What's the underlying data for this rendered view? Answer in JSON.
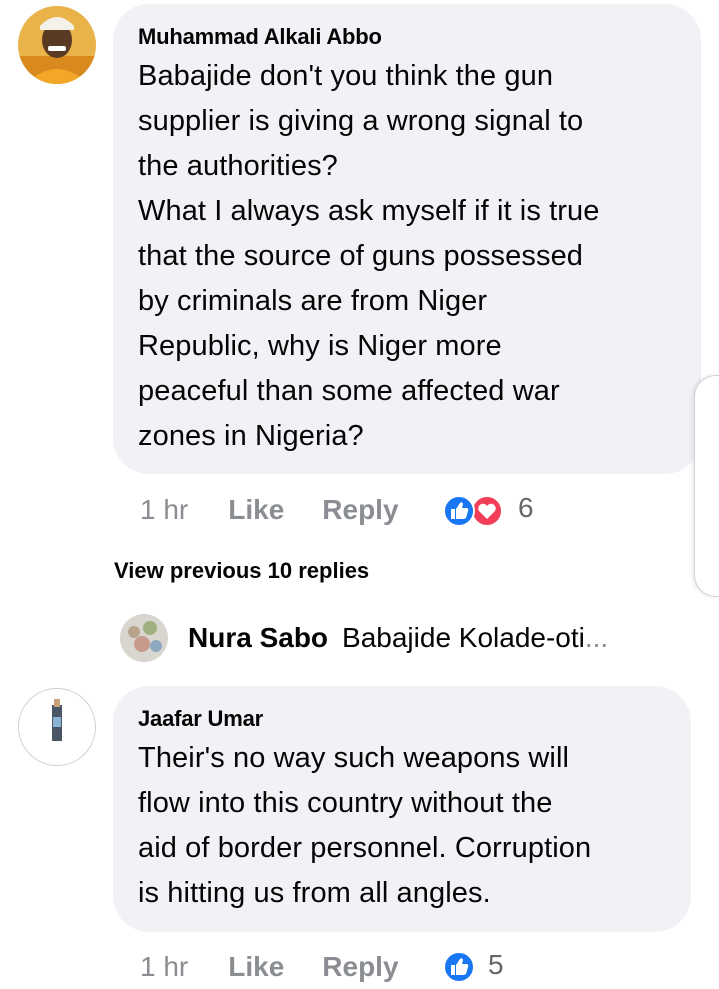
{
  "comments": [
    {
      "author": "Muhammad Alkali Abbo",
      "text": "Babajide don't you think the gun\nsupplier is giving a wrong signal to\nthe authorities?\nWhat I always ask myself if it is true\nthat the source of guns possessed\nby criminals are from Niger\nRepublic, why is Niger more\npeaceful than some affected war\nzones in Nigeria?",
      "time": "1 hr",
      "like_label": "Like",
      "reply_label": "Reply",
      "reaction_count": "6",
      "reactions": [
        "like-icon",
        "love-icon"
      ]
    },
    {
      "author": "Jaafar Umar",
      "text": "Their's no way such weapons will\nflow into this country without the\naid of border personnel. Corruption\nis hitting us from all angles.",
      "time": "1 hr",
      "like_label": "Like",
      "reply_label": "Reply",
      "reaction_count": "5",
      "reactions": [
        "like-icon"
      ]
    }
  ],
  "view_previous": "View previous 10 replies",
  "reply_preview": {
    "author": "Nura Sabo",
    "text": "Babajide Kolade-oti",
    "ellipsis": "..."
  },
  "colors": {
    "bubble": "#f0f2f5",
    "meta_grey": "#8a8d91",
    "like_blue": "#1877f2",
    "love_red": "#f33e58"
  }
}
